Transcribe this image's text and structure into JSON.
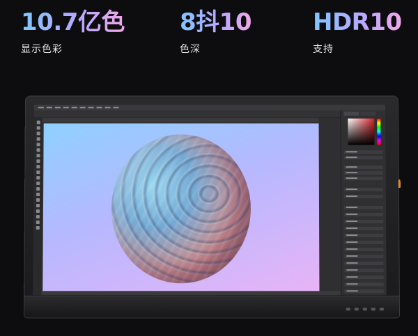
{
  "specs": [
    {
      "headline": "10.7亿色",
      "caption": "显示色彩"
    },
    {
      "headline": "8抖10",
      "caption": "色深"
    },
    {
      "headline": "HDR10",
      "caption": "支持"
    }
  ]
}
